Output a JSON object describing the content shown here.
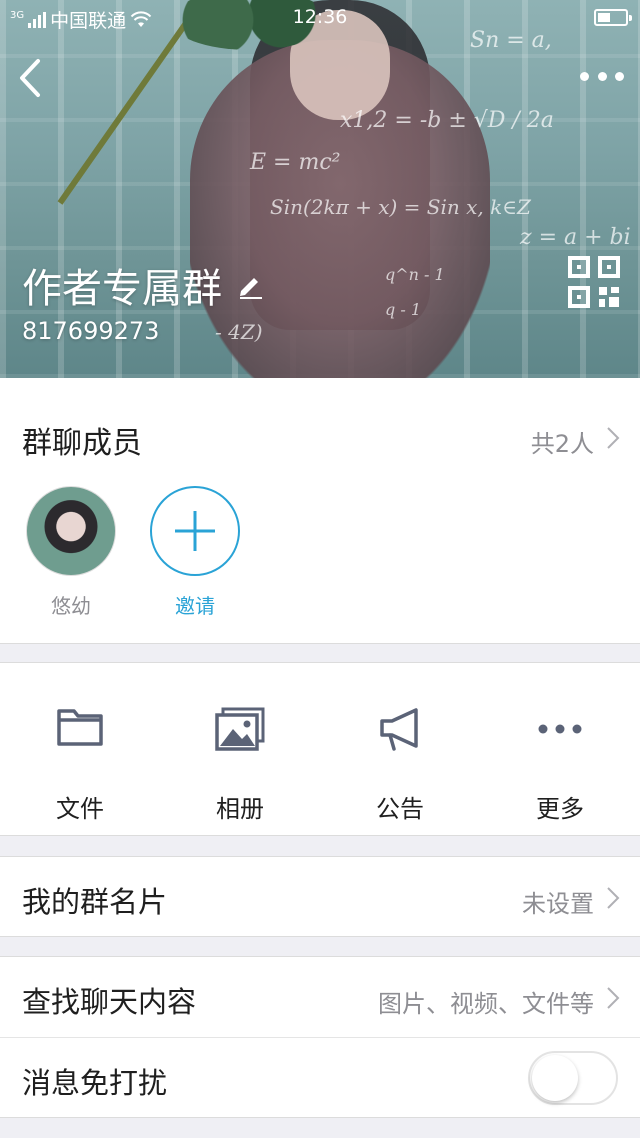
{
  "status_bar": {
    "network": "3G",
    "carrier": "中国联通",
    "time": "12:36"
  },
  "header": {
    "group_name": "作者专属群",
    "group_id": "817699273",
    "cover_formulas": [
      "z = a + bi",
      "Sn = a,",
      "E = mc²",
      "Sin(2kπ + x) = Sin x, k∈Z",
      "x1,2 = -b ± √D / 2a",
      "q^n - 1",
      "q - 1",
      "- 4Z)"
    ]
  },
  "members": {
    "title": "群聊成员",
    "count_text": "共2人",
    "list": [
      {
        "name": "悠幼"
      },
      {
        "name": "邀请"
      }
    ]
  },
  "tools": [
    {
      "label": "文件",
      "icon": "folder-icon"
    },
    {
      "label": "相册",
      "icon": "album-icon"
    },
    {
      "label": "公告",
      "icon": "announcement-icon"
    },
    {
      "label": "更多",
      "icon": "more-icon"
    }
  ],
  "rows": {
    "card": {
      "title": "我的群名片",
      "value": "未设置"
    },
    "search": {
      "title": "查找聊天内容",
      "value": "图片、视频、文件等"
    },
    "dnd": {
      "title": "消息免打扰",
      "enabled": false
    }
  },
  "colors": {
    "accent": "#2aa3d6",
    "background": "#efeff4",
    "secondary_text": "#8e8e93"
  }
}
